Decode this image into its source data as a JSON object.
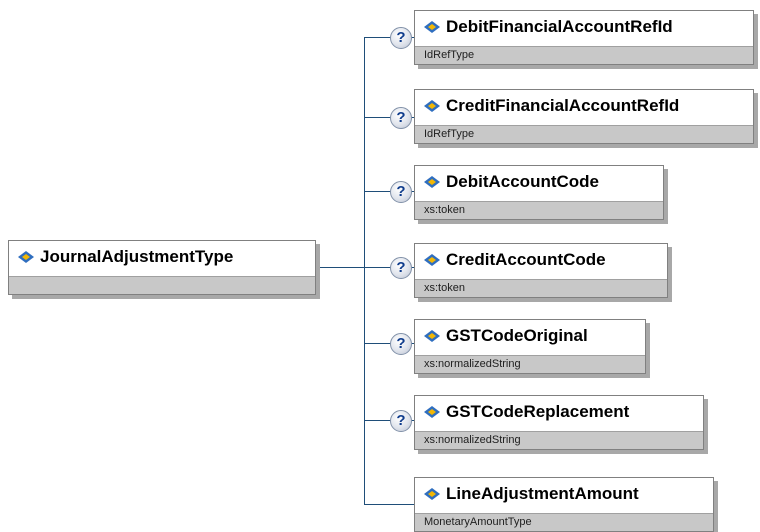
{
  "root": {
    "name": "JournalAdjustmentType",
    "type": ""
  },
  "children": [
    {
      "name": "DebitFinancialAccountRefId",
      "type": "IdRefType",
      "optional": true,
      "optional_glyph": "?"
    },
    {
      "name": "CreditFinancialAccountRefId",
      "type": "IdRefType",
      "optional": true,
      "optional_glyph": "?"
    },
    {
      "name": "DebitAccountCode",
      "type": "xs:token",
      "optional": true,
      "optional_glyph": "?"
    },
    {
      "name": "CreditAccountCode",
      "type": "xs:token",
      "optional": true,
      "optional_glyph": "?"
    },
    {
      "name": "GSTCodeOriginal",
      "type": "xs:normalizedString",
      "optional": true,
      "optional_glyph": "?"
    },
    {
      "name": "GSTCodeReplacement",
      "type": "xs:normalizedString",
      "optional": true,
      "optional_glyph": "?"
    },
    {
      "name": "LineAdjustmentAmount",
      "type": "MonetaryAmountType",
      "optional": false,
      "optional_glyph": ""
    }
  ],
  "colors": {
    "connector": "#1f4e79",
    "element_icon_fill": "#2f6ebf",
    "element_icon_accent": "#f2b705"
  }
}
